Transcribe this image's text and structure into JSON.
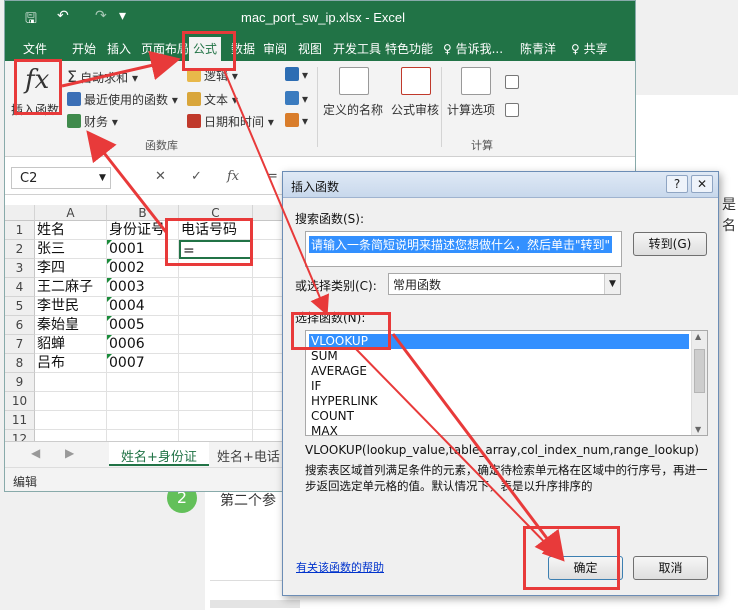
{
  "background": {
    "right_text": "是\n名",
    "step_number": "2",
    "step_text": "第二个参"
  },
  "excel": {
    "title": "mac_port_sw_ip.xlsx - Excel",
    "quick_access": {
      "save": "🖫",
      "undo": "↶",
      "redo": "↷",
      "customize": "▾"
    },
    "tabs": [
      "文件",
      "开始",
      "插入",
      "页面布局",
      "公式",
      "数据",
      "审阅",
      "视图",
      "开发工具",
      "特色功能",
      "♀ 告诉我...",
      "陈青洋",
      "♀ 共享"
    ],
    "active_tab": "公式",
    "ribbon": {
      "insert_function": "插入函数",
      "autosum": "自动求和",
      "recently_used": "最近使用的函数",
      "financial": "财务",
      "logical": "逻辑",
      "text": "文本",
      "datetime": "日期和时间",
      "group_function_library": "函数库",
      "defined_names": "定义的名称",
      "formula_auditing": "公式审核",
      "calc_options": "计算选项",
      "group_calculation": "计算"
    },
    "namebox": "C2",
    "formula_buttons": {
      "cancel": "✕",
      "enter": "✓",
      "fx": "fx",
      "equals": "="
    },
    "columns": [
      "A",
      "B",
      "C"
    ],
    "rows": [
      "1",
      "2",
      "3",
      "4",
      "5",
      "6",
      "7",
      "8",
      "9",
      "10",
      "11",
      "12"
    ],
    "cells": {
      "A": [
        "姓名",
        "张三",
        "李四",
        "王二麻子",
        "李世民",
        "秦始皇",
        "貂蝉",
        "吕布",
        "",
        "",
        "",
        ""
      ],
      "B": [
        "身份证号",
        "0001",
        "0002",
        "0003",
        "0004",
        "0005",
        "0006",
        "0007",
        "",
        "",
        "",
        ""
      ],
      "C": [
        "电话号码",
        "=",
        "",
        "",
        "",
        "",
        "",
        "",
        "",
        "",
        "",
        ""
      ]
    },
    "sheets": [
      "姓名+身份证",
      "姓名+电话"
    ],
    "status": "编辑"
  },
  "dialog": {
    "title": "插入函数",
    "help_btn": "?",
    "close_btn": "✕",
    "search_label": "搜索函数(S):",
    "search_value": "请输入一条简短说明来描述您想做什么，然后单击\"转到\"",
    "go_button": "转到(G)",
    "category_label": "或选择类别(C):",
    "category_value": "常用函数",
    "select_label": "选择函数(N):",
    "functions": [
      "VLOOKUP",
      "SUM",
      "AVERAGE",
      "IF",
      "HYPERLINK",
      "COUNT",
      "MAX"
    ],
    "selected_function": "VLOOKUP",
    "syntax": "VLOOKUP(lookup_value,table_array,col_index_num,range_lookup)",
    "description": "搜索表区域首列满足条件的元素，确定待检索单元格在区域中的行序号，再进一步返回选定单元格的值。默认情况下，表是以升序排序的",
    "help_link": "有关该函数的帮助",
    "ok": "确定",
    "cancel": "取消"
  },
  "colors": {
    "excel_green": "#217346",
    "annotation_red": "#e83a3a",
    "selection_blue": "#3390ff"
  }
}
